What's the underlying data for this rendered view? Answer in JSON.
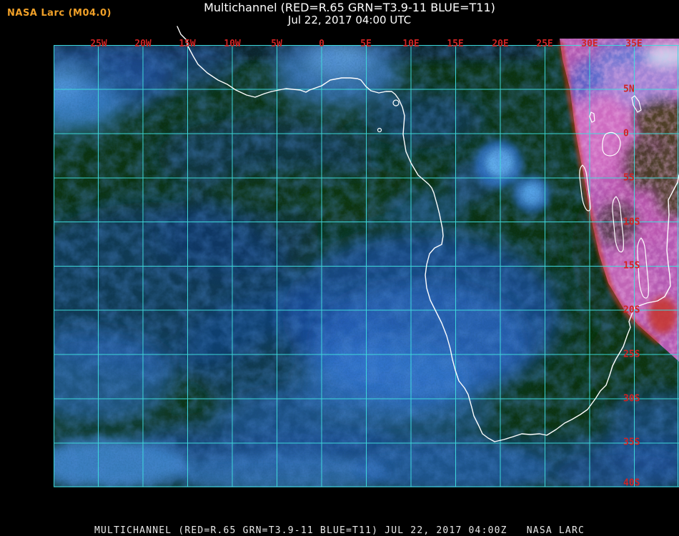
{
  "header": {
    "source_label": "NASA Larc (M04.0)",
    "title": "Multichannel (RED=R.65 GRN=T3.9-11 BLUE=T11)",
    "subtitle": "Jul 22, 2017 04:00 UTC"
  },
  "footer": {
    "caption": "MULTICHANNEL (RED=R.65 GRN=T3.9-11 BLUE=T11) JUL 22, 2017 04:00Z   NASA LARC"
  },
  "map": {
    "projection_extent": "30W-40E, 10N-40S",
    "grid_interval_deg": 5,
    "lon_labels": [
      "25W",
      "20W",
      "15W",
      "10W",
      "5W",
      "0",
      "5E",
      "10E",
      "15E",
      "20E",
      "25E",
      "30E",
      "35E"
    ],
    "lat_labels": [
      "5N",
      "0",
      "5S",
      "10S",
      "15S",
      "20S",
      "25S",
      "30S",
      "35S",
      "40S"
    ],
    "grid_color": "#3fdede",
    "label_color": "#cf2323",
    "coastline_color": "#ffffff",
    "land_night_color": "#0c3310",
    "cloud_color": "#2e6ece",
    "day_region_color": "#b45ab2",
    "terminator_color": "#c8381f"
  }
}
